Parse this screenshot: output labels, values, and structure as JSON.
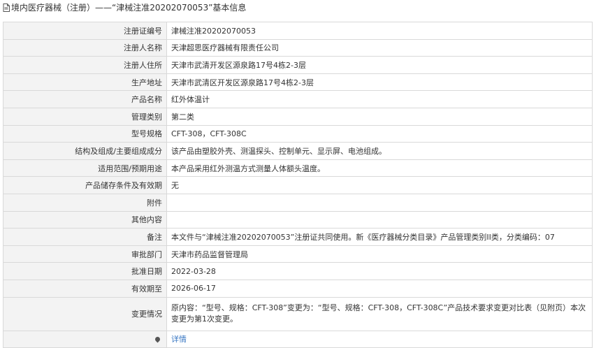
{
  "header": {
    "title": "境内医疗器械（注册）——“津械注准20202070053”基本信息"
  },
  "rows": [
    {
      "label": "注册证编号",
      "value": "津械注准20202070053"
    },
    {
      "label": "注册人名称",
      "value": "天津超思医疗器械有限责任公司"
    },
    {
      "label": "注册人住所",
      "value": "天津市武清开发区源泉路17号4栋2-3层"
    },
    {
      "label": "生产地址",
      "value": "天津市武清区开发区源泉路17号4栋2-3层"
    },
    {
      "label": "产品名称",
      "value": "红外体温计"
    },
    {
      "label": "管理类别",
      "value": "第二类"
    },
    {
      "label": "型号规格",
      "value": "CFT-308，CFT-308C"
    },
    {
      "label": "结构及组成/主要组成成分",
      "value": "该产品由塑胶外壳、测温探头、控制单元、显示屏、电池组成。"
    },
    {
      "label": "适用范围/预期用途",
      "value": "本产品采用红外测温方式测量人体额头温度。"
    },
    {
      "label": "产品储存条件及有效期",
      "value": "无"
    },
    {
      "label": "附件",
      "value": ""
    },
    {
      "label": "其他内容",
      "value": ""
    },
    {
      "label": "备注",
      "value": "本文件与“津械注准20202070053”注册证共同使用。新《医疗器械分类目录》产品管理类别II类，分类编码：07"
    },
    {
      "label": "审批部门",
      "value": "天津市药品监督管理局"
    },
    {
      "label": "批准日期",
      "value": "2022-03-28"
    },
    {
      "label": "有效期至",
      "value": "2026-06-17"
    },
    {
      "label": "变更情况",
      "value": "原内容：“型号、规格：CFT-308”变更为：“型号、规格：CFT-308，CFT-308C”产品技术要求变更对比表（见附页）本次变更为第1次变更。"
    }
  ],
  "footer": {
    "link_label": "详情"
  }
}
